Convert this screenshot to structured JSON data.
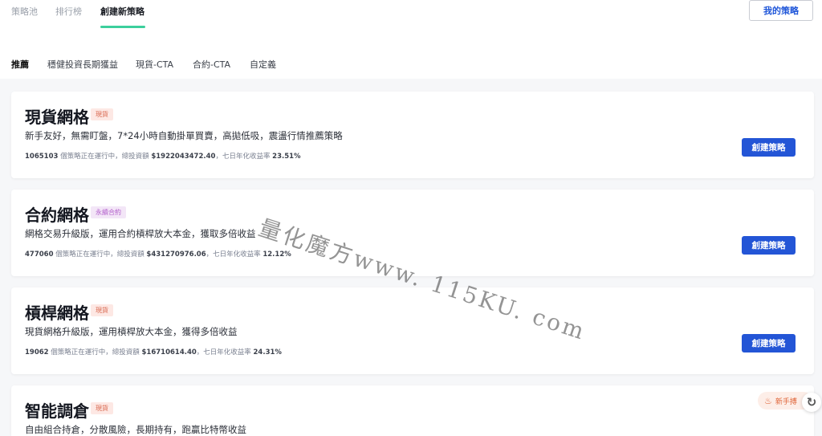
{
  "top_tabs": [
    {
      "label": "策略池"
    },
    {
      "label": "排行榜"
    },
    {
      "label": "創建新策略"
    }
  ],
  "my_strategy_label": "我的策略",
  "sub_tabs": [
    {
      "label": "推薦"
    },
    {
      "label": "穩健投資長期獲益"
    },
    {
      "label": "現貨-CTA"
    },
    {
      "label": "合約-CTA"
    },
    {
      "label": "自定義"
    }
  ],
  "cards": [
    {
      "title": "現貨網格",
      "tag": "現貨",
      "desc": "新手友好，無需盯盤，7*24小時自動掛單買賣，高拋低吸，震盪行情推薦策略",
      "count": "1065103",
      "count_text": "個策略正在運行中，總投資額",
      "amount": "$1922043472.40",
      "yield_text": "，七日年化收益率",
      "yield": "23.51%",
      "button": "創建策略"
    },
    {
      "title": "合約網格",
      "tag": "永續合約",
      "desc": "網格交易升級版，運用合約槓桿放大本金，獲取多倍收益",
      "count": "477060",
      "count_text": "個策略正在運行中，總投資額",
      "amount": "$431270976.06",
      "yield_text": "，七日年化收益率",
      "yield": "12.12%",
      "button": "創建策略"
    },
    {
      "title": "槓桿網格",
      "tag": "現貨",
      "desc": "現貨網格升級版，運用槓桿放大本金，獲得多倍收益",
      "count": "19062",
      "count_text": "個策略正在運行中，總投資額",
      "amount": "$16710614.40",
      "yield_text": "，七日年化收益率",
      "yield": "24.31%",
      "button": "創建策略"
    },
    {
      "title": "智能調倉",
      "tag": "現貨",
      "desc": "自由組合持倉，分散風險，長期持有，跑贏比特幣收益"
    }
  ],
  "watermark": "量化魔方www. 115KU. com",
  "newbie_label": "新手搏",
  "colors": {
    "accent_green": "#3ccf9c",
    "primary_blue": "#2355d6",
    "tag_spot_bg": "#fde8e4",
    "tag_perp_bg": "#f3e6f7"
  }
}
